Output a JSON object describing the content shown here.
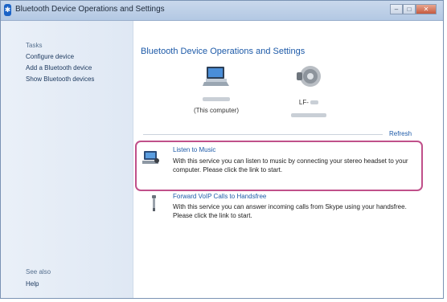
{
  "window": {
    "title": "Bluetooth Device Operations and Settings"
  },
  "sidebar": {
    "heading": "Tasks",
    "links": [
      {
        "label": "Configure device"
      },
      {
        "label": "Add a Bluetooth device"
      },
      {
        "label": "Show Bluetooth devices"
      }
    ],
    "see_also": "See also",
    "help": "Help"
  },
  "main": {
    "title": "Bluetooth Device Operations and Settings",
    "computer_caption": "(This computer)",
    "headset_name": "LF-",
    "refresh": "Refresh",
    "services": [
      {
        "title": "Listen to Music",
        "description": "With this service you can listen to music by connecting your stereo headset to your computer. Please click the link to start."
      },
      {
        "title": "Forward VoIP Calls to Handsfree",
        "description": "With this service you can answer incoming calls from Skype using your handsfree. Please click the link to start."
      }
    ]
  },
  "colors": {
    "highlight": "#c0508a",
    "link": "#1d5aa8"
  }
}
